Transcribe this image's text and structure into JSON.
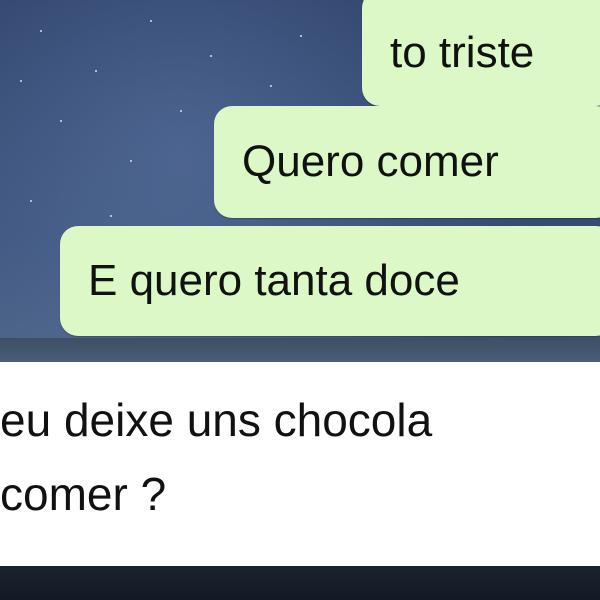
{
  "chat": {
    "outgoing": [
      {
        "text": "to triste"
      },
      {
        "text": "Quero comer"
      },
      {
        "text": "E quero tanta doce"
      }
    ],
    "incoming": {
      "line1": "eu deixe uns chocola",
      "line2": "comer ?"
    }
  },
  "colors": {
    "outgoing_bubble": "#dcf8c6",
    "incoming_bubble": "#ffffff"
  }
}
